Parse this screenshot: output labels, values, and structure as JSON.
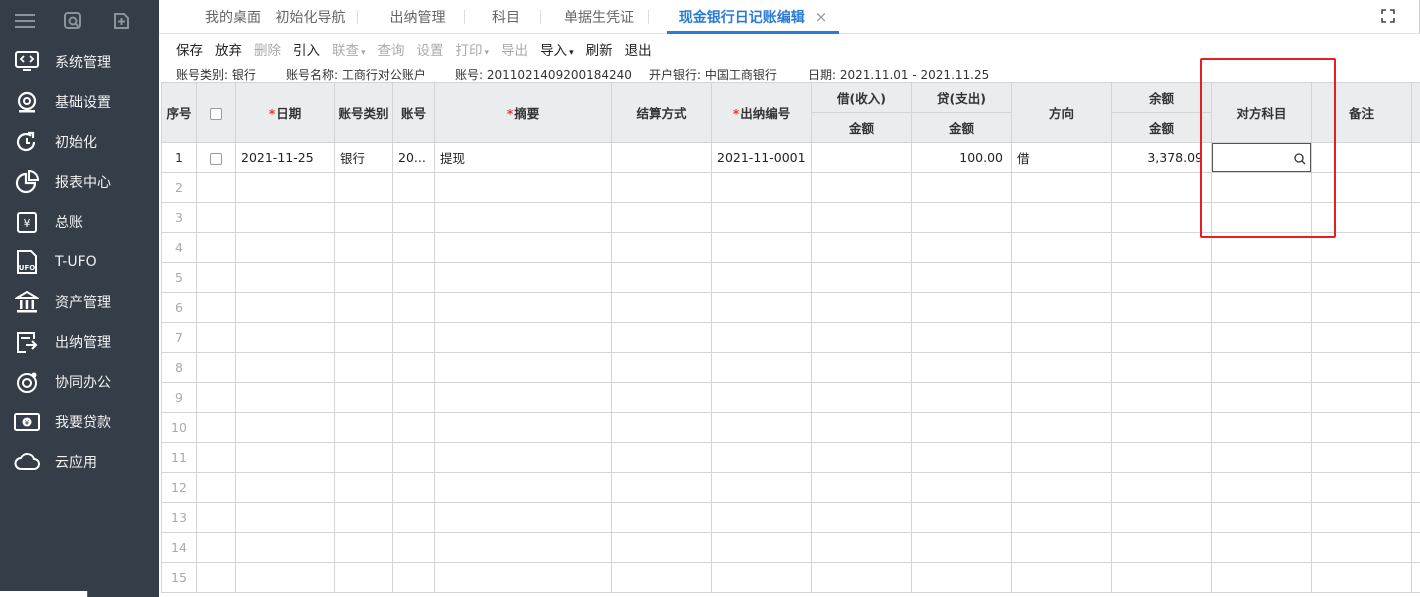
{
  "sidebar": {
    "items": [
      {
        "label": "系统管理",
        "icon": "system-management-icon"
      },
      {
        "label": "基础设置",
        "icon": "basic-settings-icon"
      },
      {
        "label": "初始化",
        "icon": "initialize-icon"
      },
      {
        "label": "报表中心",
        "icon": "report-center-icon"
      },
      {
        "label": "总账",
        "icon": "general-ledger-icon"
      },
      {
        "label": "T-UFO",
        "icon": "t-ufo-icon"
      },
      {
        "label": "资产管理",
        "icon": "asset-management-icon"
      },
      {
        "label": "出纳管理",
        "icon": "cashier-management-icon"
      },
      {
        "label": "协同办公",
        "icon": "collaboration-icon"
      },
      {
        "label": "我要贷款",
        "icon": "loan-icon"
      },
      {
        "label": "云应用",
        "icon": "cloud-app-icon"
      }
    ]
  },
  "tabs": [
    {
      "label": "我的桌面"
    },
    {
      "label": "初始化导航"
    },
    {
      "label": "出纳管理"
    },
    {
      "label": "科目"
    },
    {
      "label": "单据生凭证"
    },
    {
      "label": "现金银行日记账编辑",
      "active": true,
      "close": "×"
    }
  ],
  "toolbar": {
    "save": "保存",
    "discard": "放弃",
    "delete": "删除",
    "import_ref": "引入",
    "linked_query": "联查",
    "query": "查询",
    "settings": "设置",
    "print": "打印",
    "export": "导出",
    "import": "导入",
    "refresh": "刷新",
    "exit": "退出"
  },
  "info": {
    "account_type": "账号类别: 银行",
    "account_name": "账号名称: 工商行对公账户",
    "account_no": "账号: 2011021409200184240",
    "bank": "开户银行: 中国工商银行",
    "date_range": "日期: 2021.11.01 - 2021.11.25"
  },
  "grid": {
    "headers": {
      "seq": "序号",
      "date": "日期",
      "acct_type": "账号类别",
      "acct_no": "账号",
      "summary": "摘要",
      "settle": "结算方式",
      "cash_no": "出纳编号",
      "debit": "借(收入)",
      "credit": "贷(支出)",
      "amount": "金额",
      "direction": "方向",
      "balance": "余额",
      "counter_subject": "对方科目",
      "remark": "备注"
    },
    "row1": {
      "seq": "1",
      "date": "2021-11-25",
      "acct_type": "银行",
      "acct_no": "20...",
      "summary": "提现",
      "settle": "",
      "cash_no": "2021-11-0001",
      "debit": "",
      "credit": "100.00",
      "direction": "借",
      "balance": "3,378.09",
      "counter_subject": "",
      "remark": ""
    },
    "row_numbers": [
      "2",
      "3",
      "4",
      "5",
      "6",
      "7",
      "8",
      "9",
      "10",
      "11",
      "12",
      "13",
      "14",
      "15"
    ]
  },
  "colors": {
    "sidebar_bg": "#353d49",
    "accent": "#2b7bd6",
    "highlight": "#e5211f"
  }
}
